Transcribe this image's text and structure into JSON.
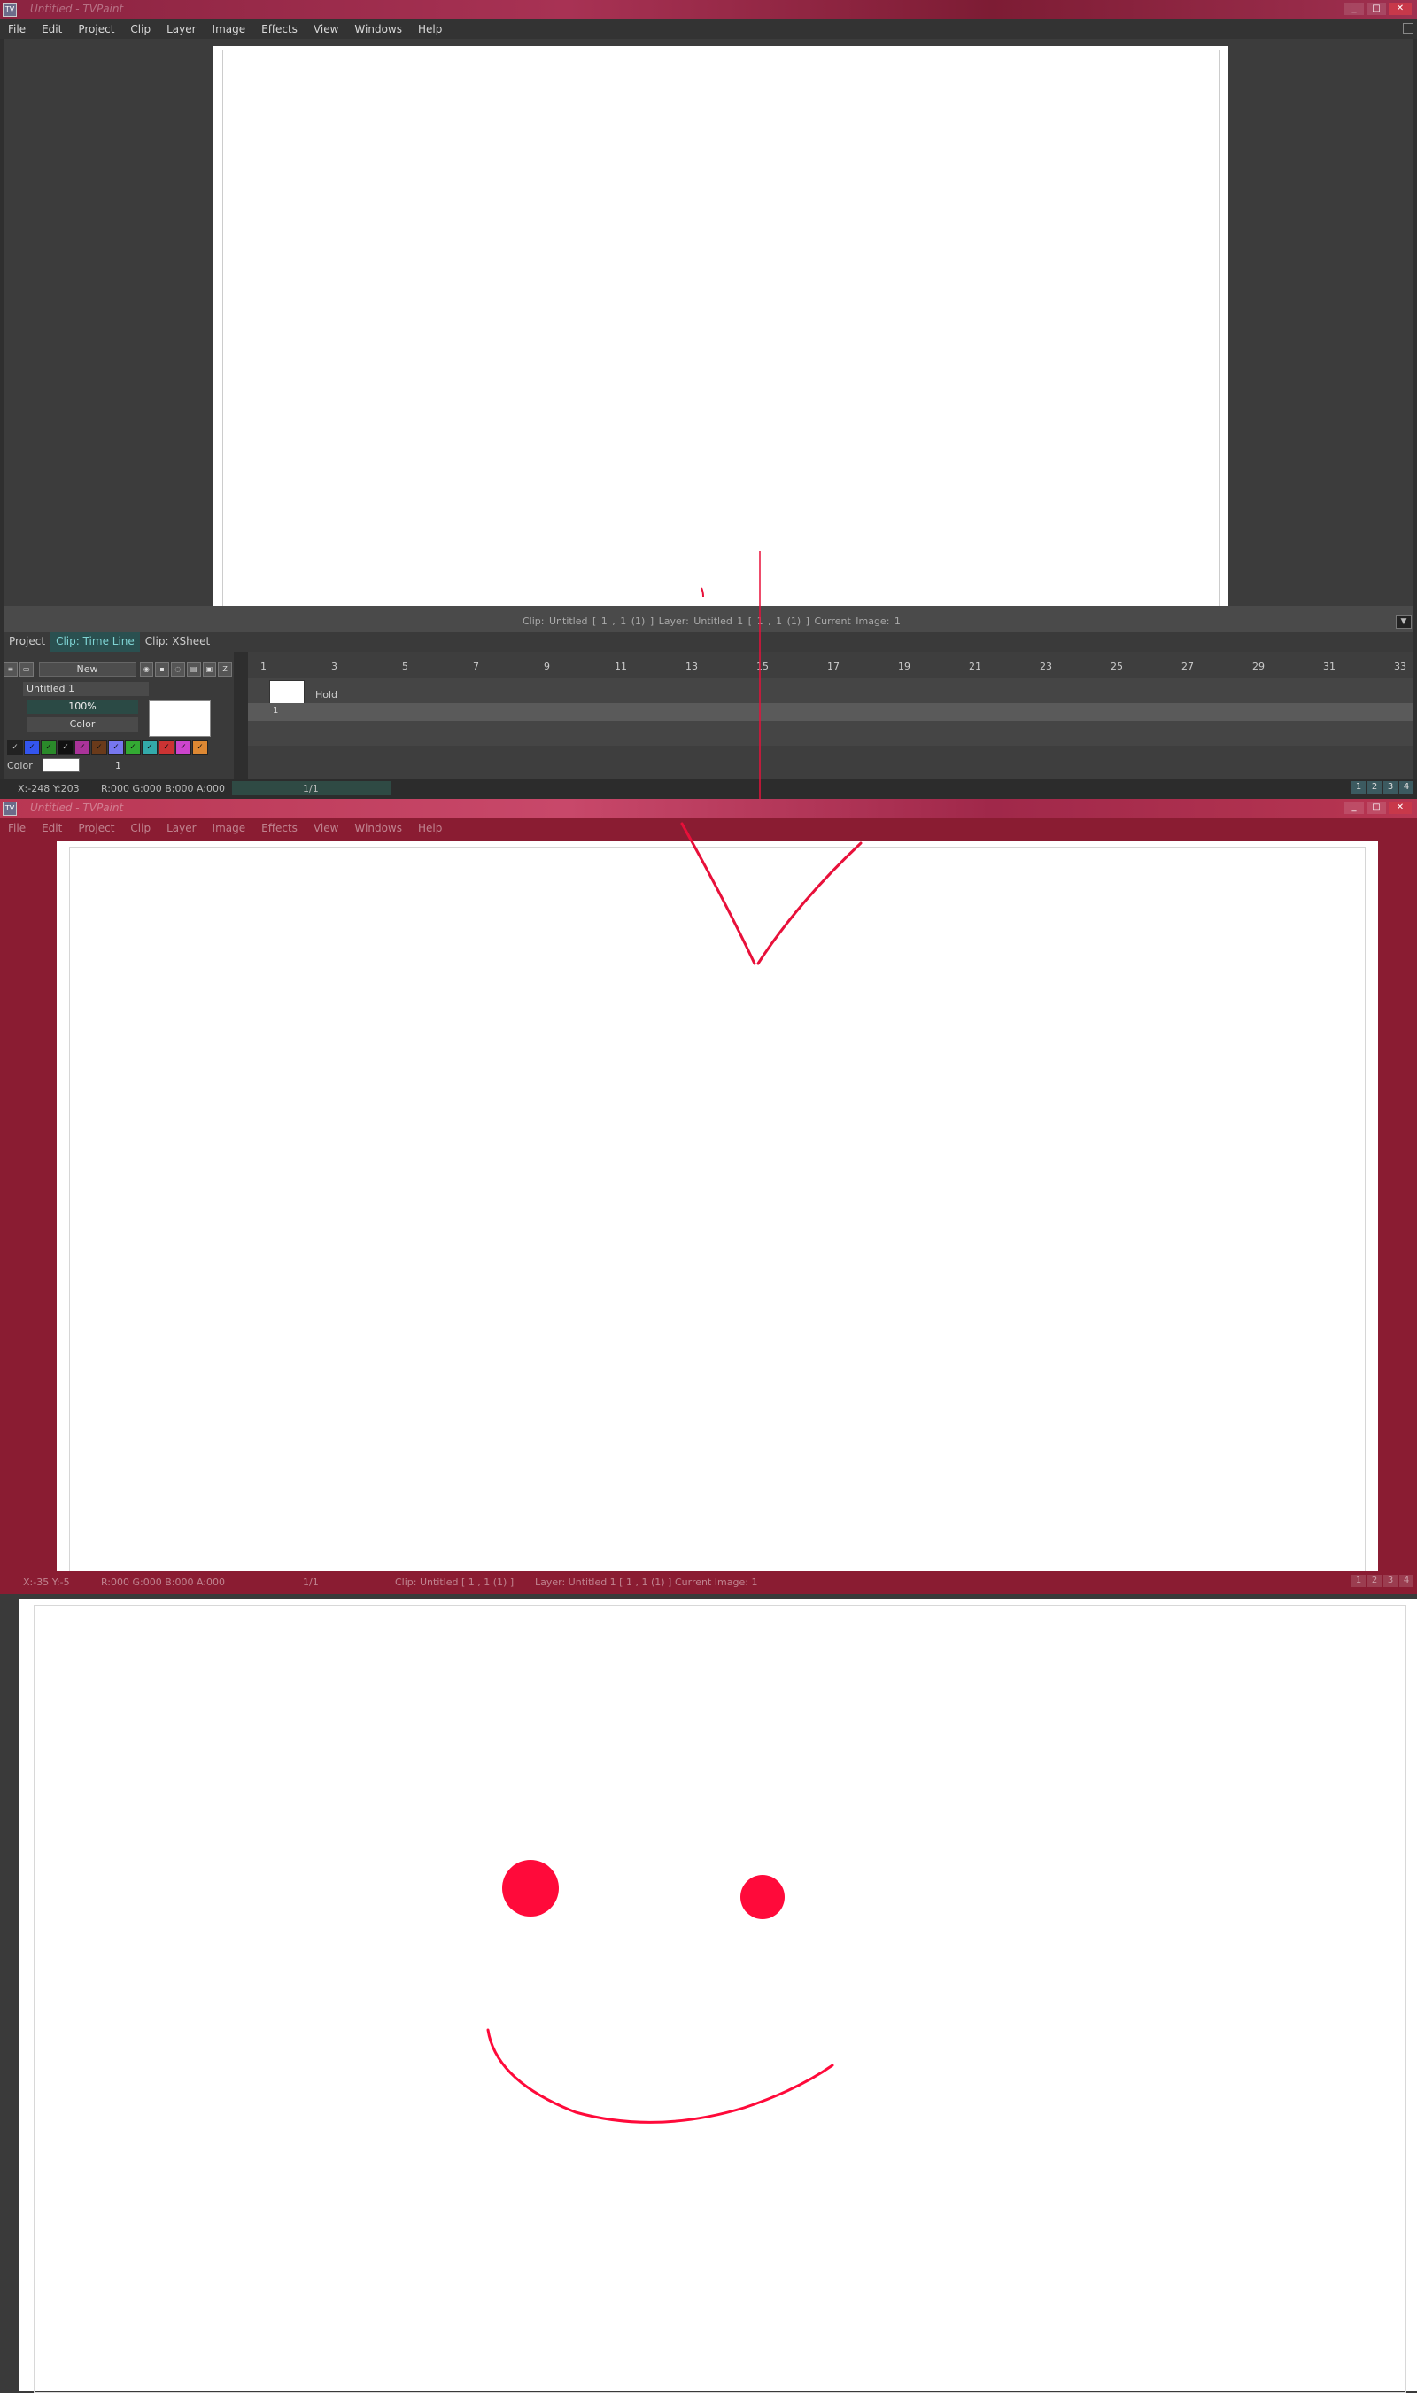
{
  "app": {
    "window_title": "Untitled - TVPaint",
    "window_buttons": [
      "_",
      "□",
      "✕"
    ]
  },
  "menu": [
    "File",
    "Edit",
    "Project",
    "Clip",
    "Layer",
    "Image",
    "Effects",
    "View",
    "Windows",
    "Help"
  ],
  "clip_status": "Clip: Untitled [ 1 , 1  (1) ]      Layer: Untitled 1 [ 1 , 1  (1) ]      Current Image: 1",
  "panel_tabs": [
    "Project",
    "Clip: Time Line",
    "Clip: XSheet"
  ],
  "timeline": {
    "new_button": "New",
    "layer_name": "Untitled 1",
    "opacity": "100%",
    "blend_mode": "Color",
    "hold": "Hold",
    "cell_number": "1",
    "frame_numbers": [
      "1",
      "3",
      "5",
      "7",
      "9",
      "11",
      "13",
      "15",
      "17",
      "19",
      "21",
      "23",
      "25",
      "27",
      "29",
      "31",
      "33"
    ],
    "color_label": "Color",
    "color_index": "1",
    "swatch_colors": [
      "#222222",
      "#3355ee",
      "#2a8a2a",
      "#111111",
      "#aa3399",
      "#6a3a1a",
      "#7777ee",
      "#33aa33",
      "#33aaaa",
      "#cc3333",
      "#cc44cc",
      "#dd8833"
    ]
  },
  "status1": {
    "coords": "X:-248  Y:203",
    "rgba": "R:000 G:000 B:000 A:000",
    "frame": "1/1"
  },
  "status2": {
    "coords": "X:-35  Y:-5",
    "rgba": "R:000 G:000 B:000 A:000",
    "frame": "1/1",
    "clip": "Clip: Untitled [ 1 , 1  (1) ]",
    "layer": "Layer: Untitled 1 [ 1 , 1  (1) ]",
    "image": "Current Image: 1"
  },
  "page_buttons": [
    "1",
    "2",
    "3",
    "4"
  ],
  "colors": {
    "accent_red": "#e8103a",
    "titlebar": "#a83254",
    "window2_bg": "#8a1c32"
  }
}
